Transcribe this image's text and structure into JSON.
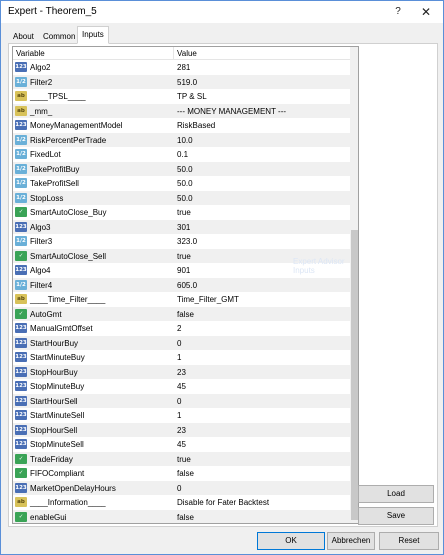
{
  "window": {
    "title": "Expert - Theorem_5",
    "help_glyph": "?",
    "close_glyph": "✕"
  },
  "tabs": [
    {
      "label": "About"
    },
    {
      "label": "Common"
    },
    {
      "label": "Inputs"
    }
  ],
  "grid": {
    "col_variable": "Variable",
    "col_value": "Value",
    "rows": [
      {
        "type": "int",
        "icon_text": "123",
        "name": "Algo2",
        "value": "281"
      },
      {
        "type": "dbl",
        "icon_text": "1/2",
        "name": "Filter2",
        "value": "519.0"
      },
      {
        "type": "str",
        "icon_text": "ab",
        "name": "____TPSL____",
        "value": "TP & SL"
      },
      {
        "type": "str",
        "icon_text": "ab",
        "name": "_mm_",
        "value": "--- MONEY MANAGEMENT ---"
      },
      {
        "type": "int",
        "icon_text": "123",
        "name": "MoneyManagementModel",
        "value": "RiskBased"
      },
      {
        "type": "dbl",
        "icon_text": "1/2",
        "name": "RiskPercentPerTrade",
        "value": "10.0"
      },
      {
        "type": "dbl",
        "icon_text": "1/2",
        "name": "FixedLot",
        "value": "0.1"
      },
      {
        "type": "dbl",
        "icon_text": "1/2",
        "name": "TakeProfitBuy",
        "value": "50.0"
      },
      {
        "type": "dbl",
        "icon_text": "1/2",
        "name": "TakeProfitSell",
        "value": "50.0"
      },
      {
        "type": "dbl",
        "icon_text": "1/2",
        "name": "StopLoss",
        "value": "50.0"
      },
      {
        "type": "bool",
        "icon_text": "✓",
        "name": "SmartAutoClose_Buy",
        "value": "true"
      },
      {
        "type": "int",
        "icon_text": "123",
        "name": "Algo3",
        "value": "301"
      },
      {
        "type": "dbl",
        "icon_text": "1/2",
        "name": "Filter3",
        "value": "323.0"
      },
      {
        "type": "bool",
        "icon_text": "✓",
        "name": "SmartAutoClose_Sell",
        "value": "true"
      },
      {
        "type": "int",
        "icon_text": "123",
        "name": "Algo4",
        "value": "901"
      },
      {
        "type": "dbl",
        "icon_text": "1/2",
        "name": "Filter4",
        "value": "605.0"
      },
      {
        "type": "str",
        "icon_text": "ab",
        "name": "____Time_Filter____",
        "value": "Time_Filter_GMT"
      },
      {
        "type": "bool",
        "icon_text": "✓",
        "name": "AutoGmt",
        "value": "false"
      },
      {
        "type": "int",
        "icon_text": "123",
        "name": "ManualGmtOffset",
        "value": "2"
      },
      {
        "type": "int",
        "icon_text": "123",
        "name": "StartHourBuy",
        "value": "0"
      },
      {
        "type": "int",
        "icon_text": "123",
        "name": "StartMinuteBuy",
        "value": "1"
      },
      {
        "type": "int",
        "icon_text": "123",
        "name": "StopHourBuy",
        "value": "23"
      },
      {
        "type": "int",
        "icon_text": "123",
        "name": "StopMinuteBuy",
        "value": "45"
      },
      {
        "type": "int",
        "icon_text": "123",
        "name": "StartHourSell",
        "value": "0"
      },
      {
        "type": "int",
        "icon_text": "123",
        "name": "StartMinuteSell",
        "value": "1"
      },
      {
        "type": "int",
        "icon_text": "123",
        "name": "StopHourSell",
        "value": "23"
      },
      {
        "type": "int",
        "icon_text": "123",
        "name": "StopMinuteSell",
        "value": "45"
      },
      {
        "type": "bool",
        "icon_text": "✓",
        "name": "TradeFriday",
        "value": "true"
      },
      {
        "type": "bool",
        "icon_text": "✓",
        "name": "FIFOCompliant",
        "value": "false"
      },
      {
        "type": "int",
        "icon_text": "123",
        "name": "MarketOpenDelayHours",
        "value": "0"
      },
      {
        "type": "str",
        "icon_text": "ab",
        "name": "____Information____",
        "value": "Disable for Fater Backtest"
      },
      {
        "type": "bool",
        "icon_text": "✓",
        "name": "enableGui",
        "value": "false"
      }
    ]
  },
  "watermark": "Expert Advisor Inputs",
  "side_buttons": {
    "load": "Load",
    "save": "Save"
  },
  "footer": {
    "ok": "OK",
    "cancel": "Abbrechen",
    "reset": "Reset"
  }
}
